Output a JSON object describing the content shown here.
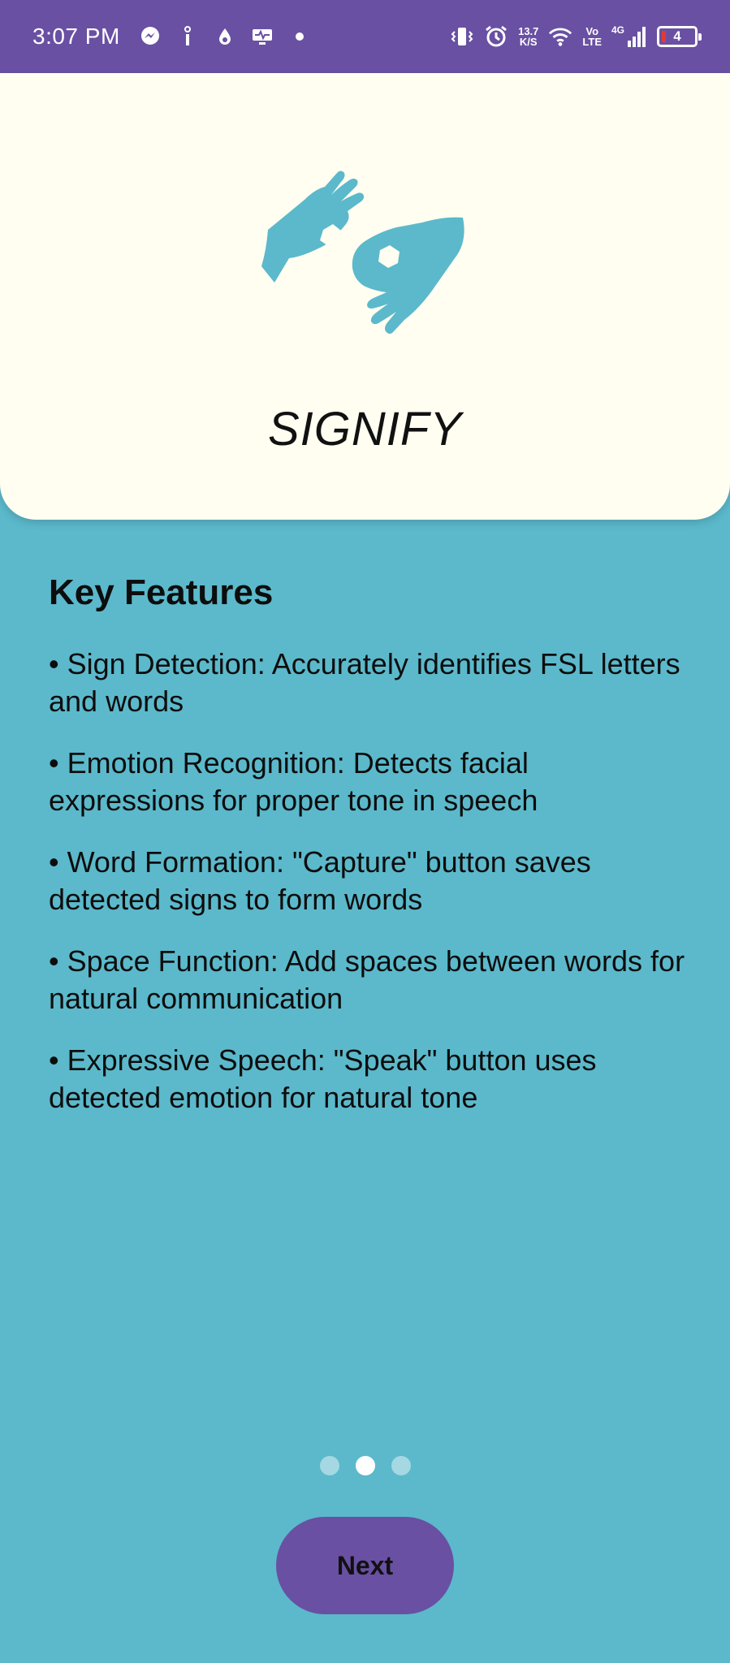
{
  "status_bar": {
    "time": "3:07 PM",
    "net_speed_value": "13.7",
    "net_speed_unit": "K/S",
    "volte_top": "Vo",
    "volte_bottom": "LTE",
    "network_type": "4G",
    "battery_level": "4"
  },
  "hero": {
    "app_name": "SIGNIFY",
    "logo_color": "#5BB9CB"
  },
  "features": {
    "title": "Key Features",
    "items": [
      "• Sign Detection: Accurately identifies FSL letters and words",
      "• Emotion Recognition: Detects facial expressions for proper tone in speech",
      "• Word Formation: \"Capture\" button saves detected signs to form words",
      "• Space Function: Add spaces between words for natural communication",
      "• Expressive Speech: \"Speak\" button uses detected emotion for natural tone"
    ]
  },
  "pager": {
    "count": 3,
    "active_index": 1
  },
  "next_button_label": "Next",
  "colors": {
    "status_bar": "#6950A3",
    "background": "#5BB9CB",
    "card": "#FFFEF1",
    "button": "#6950A3"
  }
}
